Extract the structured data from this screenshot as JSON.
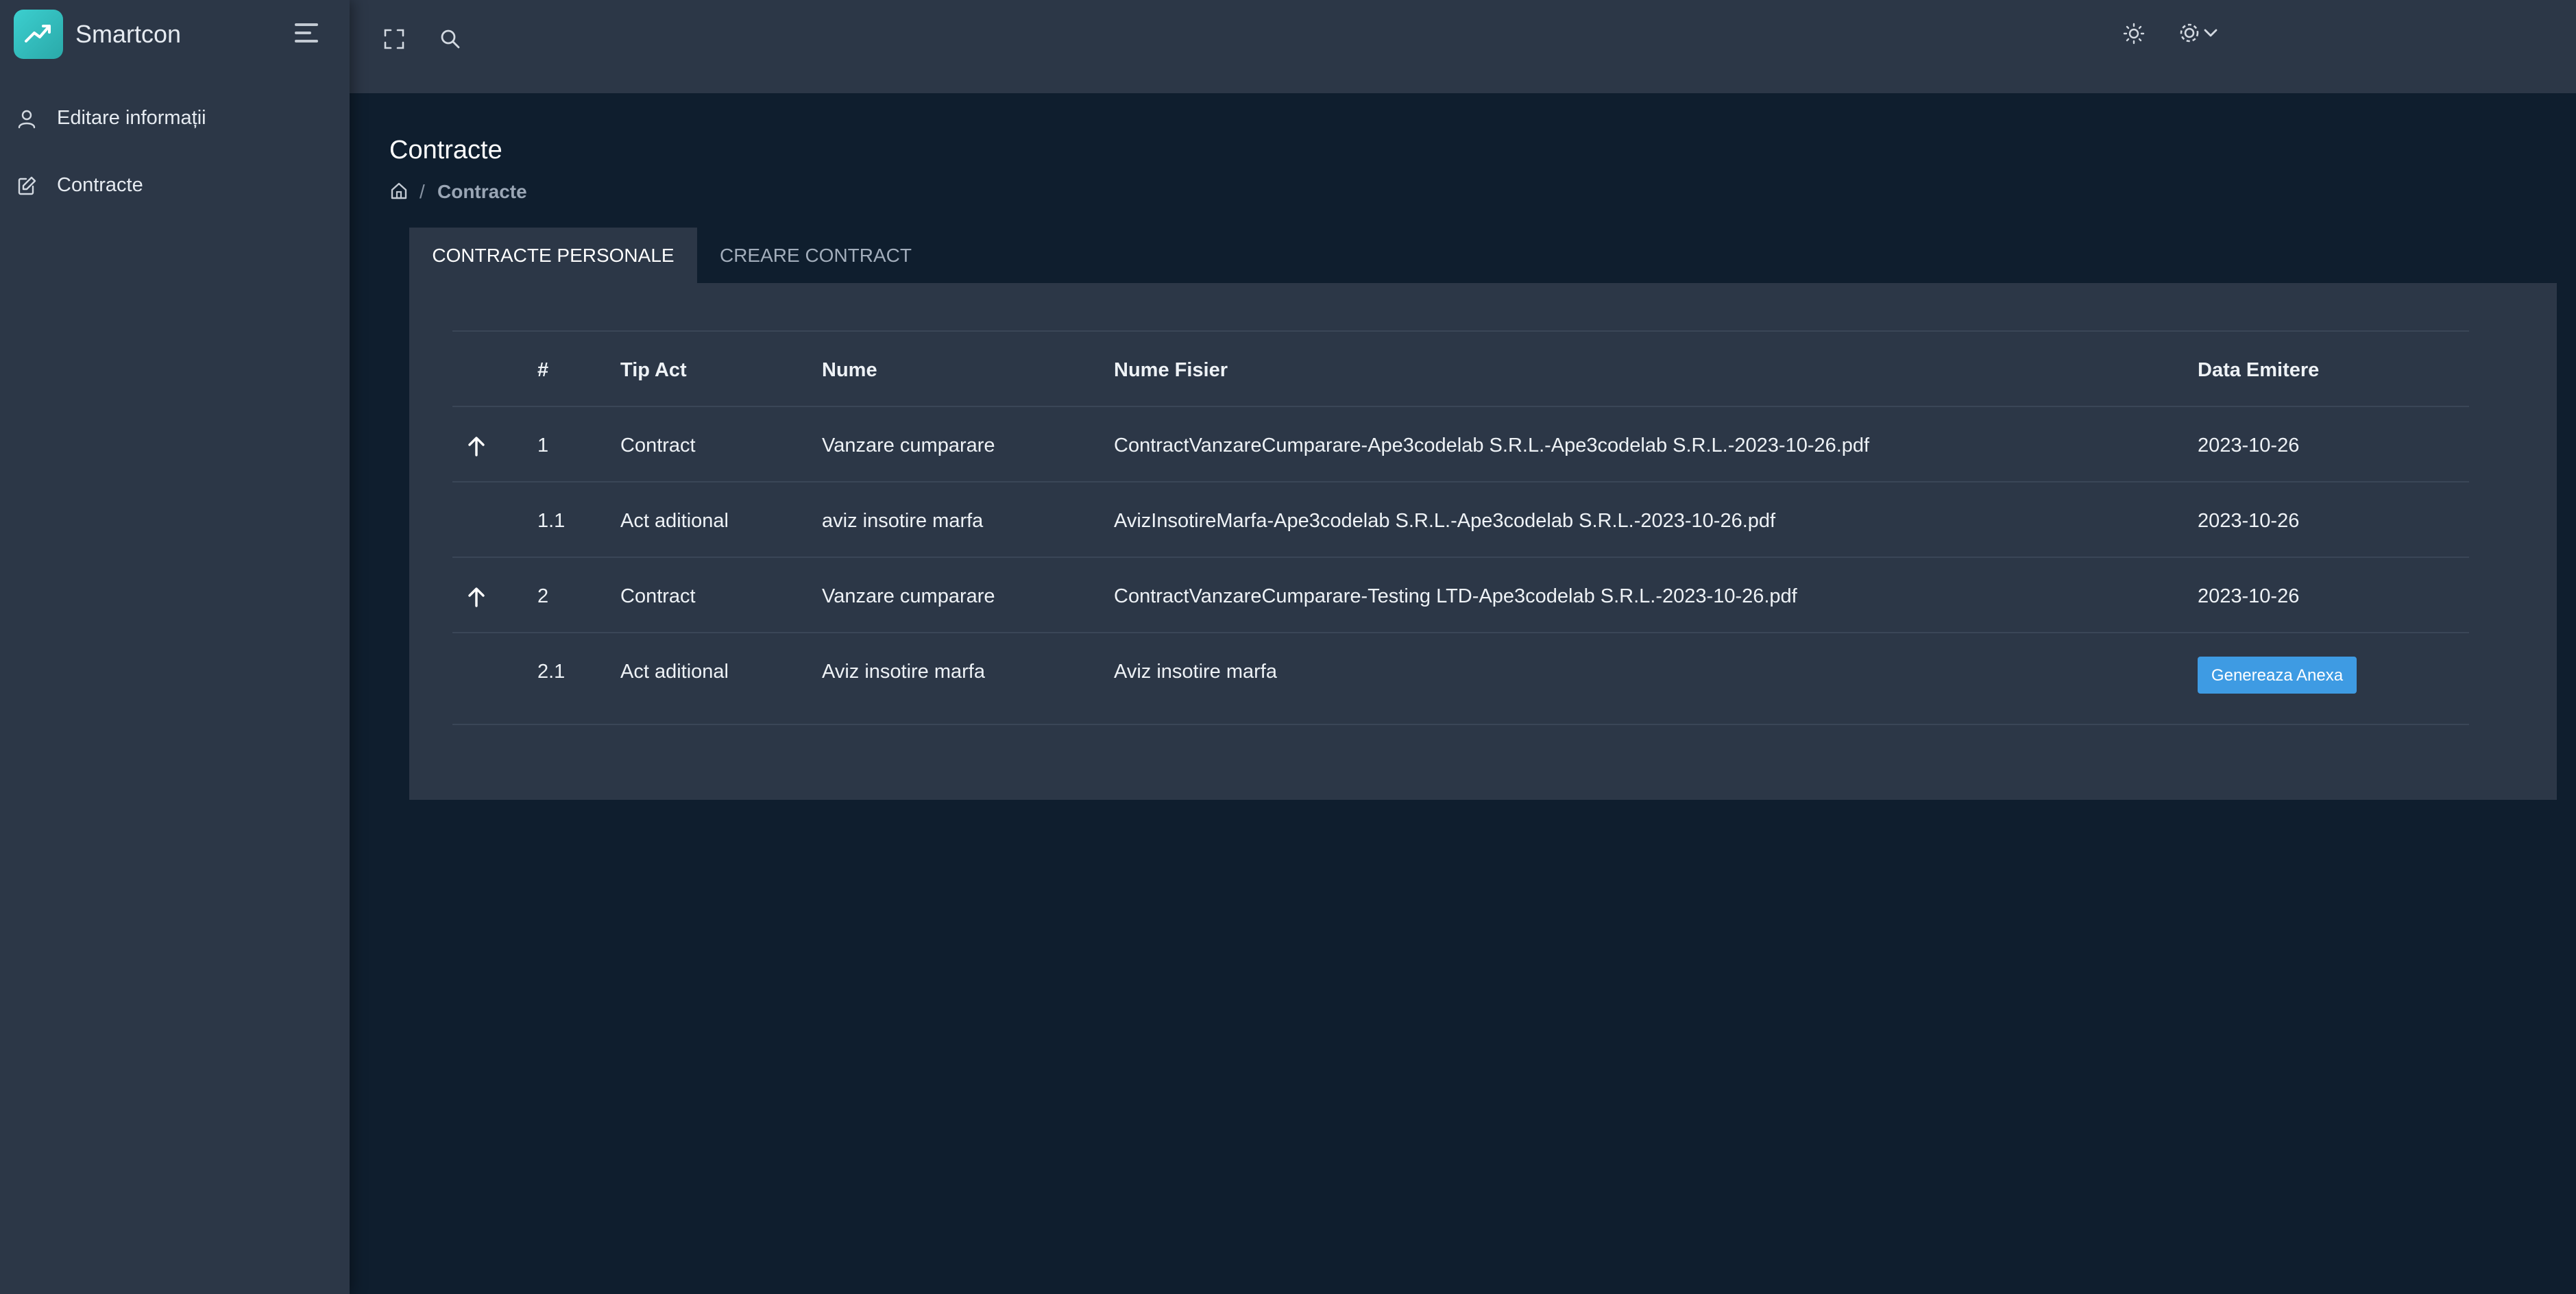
{
  "app": {
    "name": "Smartcon"
  },
  "sidebar": {
    "items": [
      {
        "label": "Editare informații",
        "icon": "user-icon"
      },
      {
        "label": "Contracte",
        "icon": "edit-icon"
      }
    ]
  },
  "topbar": {
    "icons": [
      "fullscreen-icon",
      "search-icon",
      "sun-icon",
      "gear-icon",
      "chevron-down-icon"
    ]
  },
  "page": {
    "title": "Contracte",
    "breadcrumb": {
      "separator": "/",
      "current": "Contracte"
    }
  },
  "tabs": [
    {
      "label": "CONTRACTE PERSONALE",
      "active": true
    },
    {
      "label": "CREARE CONTRACT",
      "active": false
    }
  ],
  "table": {
    "columns": [
      "#",
      "Tip Act",
      "Nume",
      "Nume Fisier",
      "Data Emitere"
    ],
    "rows": [
      {
        "expand": true,
        "num": "1",
        "tip": "Contract",
        "nume": "Vanzare cumparare",
        "fisier": "ContractVanzareCumparare-Ape3codelab S.R.L.-Ape3codelab S.R.L.-2023-10-26.pdf",
        "data": "2023-10-26"
      },
      {
        "expand": false,
        "num": "1.1",
        "tip": "Act aditional",
        "nume": "aviz insotire marfa",
        "fisier": "AvizInsotireMarfa-Ape3codelab S.R.L.-Ape3codelab S.R.L.-2023-10-26.pdf",
        "data": "2023-10-26"
      },
      {
        "expand": true,
        "num": "2",
        "tip": "Contract",
        "nume": "Vanzare cumparare",
        "fisier": "ContractVanzareCumparare-Testing LTD-Ape3codelab S.R.L.-2023-10-26.pdf",
        "data": "2023-10-26"
      },
      {
        "expand": false,
        "num": "2.1",
        "tip": "Act aditional",
        "nume": "Aviz insotire marfa",
        "fisier": "Aviz insotire marfa",
        "data": ""
      }
    ],
    "action_button": "Genereaza Anexa"
  },
  "colors": {
    "background": "#0f1e2e",
    "panel": "#2c3747",
    "accent": "#3e9be3",
    "logo": "#3ccfcf"
  }
}
